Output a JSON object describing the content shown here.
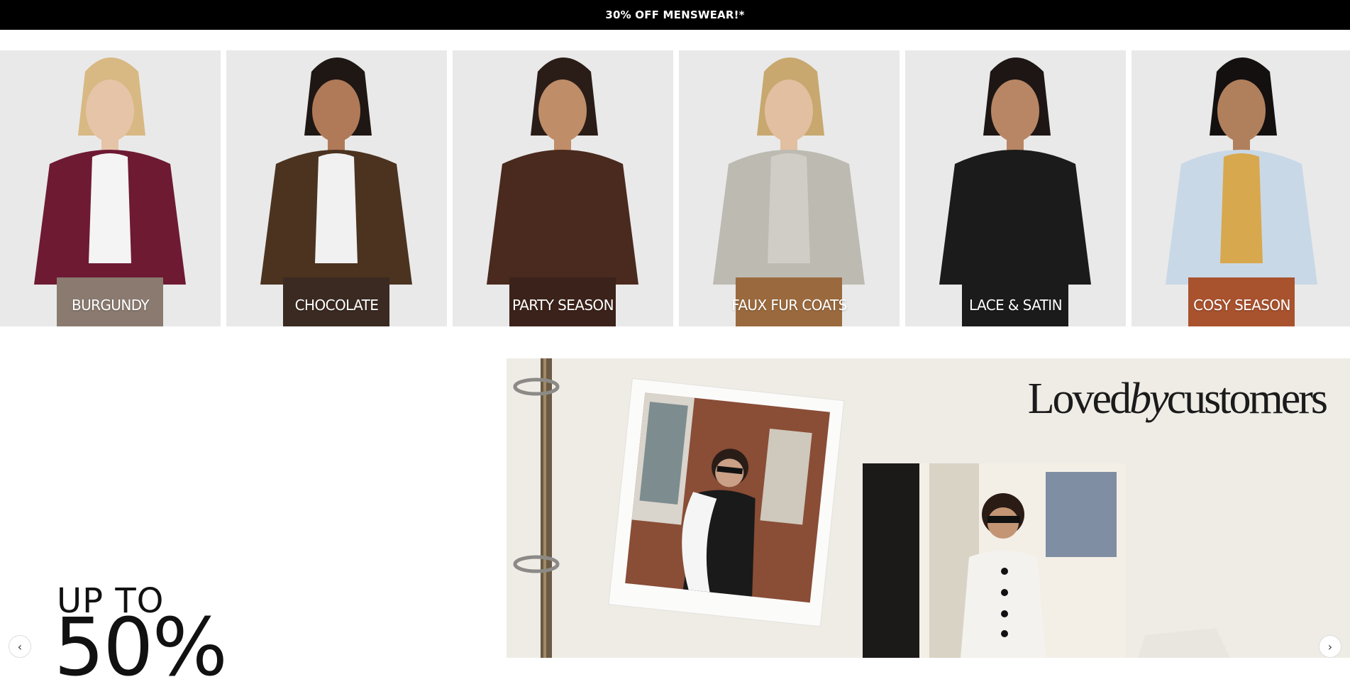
{
  "promo": {
    "text": "30% OFF MENSWEAR!*"
  },
  "categories": [
    {
      "label": "BURGUNDY",
      "garment": "#6e1a33",
      "inner": "#f4f4f4",
      "skin": "#e6c4a8",
      "hair": "#d8b883",
      "lower": "#8a7a70"
    },
    {
      "label": "CHOCOLATE",
      "garment": "#4b3320",
      "inner": "#f1f1f1",
      "skin": "#b07a58",
      "hair": "#1e1714",
      "lower": "#3a2a22"
    },
    {
      "label": "PARTY SEASON",
      "garment": "#4a2a1e",
      "inner": "#4a2a1e",
      "skin": "#c08d69",
      "hair": "#2a1d17",
      "lower": "#3b221a"
    },
    {
      "label": "FAUX FUR COATS",
      "garment": "#bdbab2",
      "inner": "#d0cdc6",
      "skin": "#e2bfa0",
      "hair": "#c8a86e",
      "lower": "#9a6a3e"
    },
    {
      "label": "LACE & SATIN",
      "garment": "#1b1b1b",
      "inner": "#1b1b1b",
      "skin": "#b88664",
      "hair": "#1d1614",
      "lower": "#1b1b1b"
    },
    {
      "label": "COSY SEASON",
      "garment": "#c9d8e6",
      "inner": "#d8a84e",
      "skin": "#b0805d",
      "hair": "#151010",
      "lower": "#a8522e"
    }
  ],
  "hero": {
    "upto": "UP TO",
    "percent": "50%",
    "loved": "Loved",
    "by": "by",
    "customers": "customers"
  },
  "nav": {
    "prev": "‹",
    "next": "›"
  }
}
